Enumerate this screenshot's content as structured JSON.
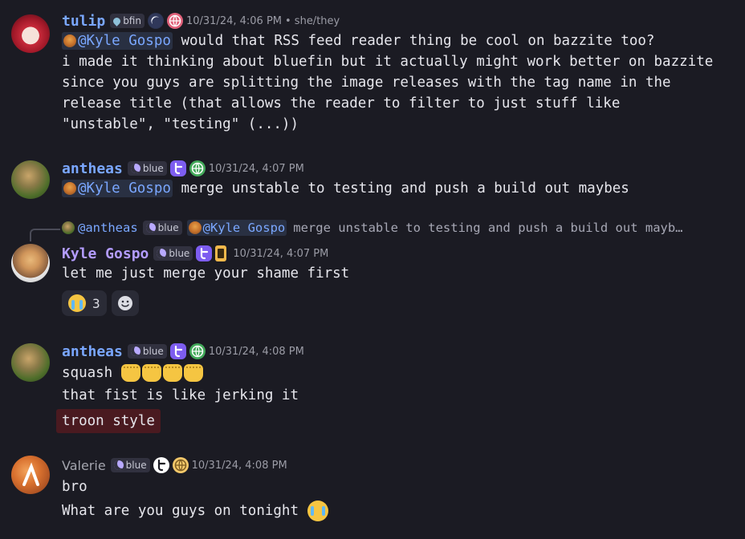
{
  "messages": [
    {
      "author": "tulip",
      "name_color": "#7aa7ff",
      "tag": "bfin",
      "timestamp": "10/31/24, 4:06 PM",
      "pronouns": "• she/they",
      "mention": "@Kyle Gospo",
      "first_line": " would that RSS feed reader thing be cool on bazzite too?",
      "rest": "i made it thinking about bluefin but it actually might work better on bazzite since you guys are splitting the image releases with the tag name in the release title (that allows the reader to filter to just stuff like \"unstable\", \"testing\" (...))"
    },
    {
      "author": "antheas",
      "name_color": "#7aa7ff",
      "tag": "blue",
      "timestamp": "10/31/24, 4:07 PM",
      "mention": "@Kyle Gospo",
      "text": " merge unstable to testing and push a build out maybes"
    },
    {
      "author": "Kyle Gospo",
      "name_color": "#b39cff",
      "tag": "blue",
      "timestamp": "10/31/24, 4:07 PM",
      "reply": {
        "author": "@antheas",
        "tag": "blue",
        "mention": "@Kyle Gospo",
        "text": "merge unstable to testing and push a build out mayb…"
      },
      "text": "let me just merge your shame first",
      "reactions": [
        {
          "emoji": "loudly-crying-face",
          "count": "3"
        },
        {
          "emoji": "add-reaction"
        }
      ]
    },
    {
      "author": "antheas",
      "name_color": "#7aa7ff",
      "tag": "blue",
      "timestamp": "10/31/24, 4:08 PM",
      "lines": [
        "squash",
        "that fist is like jerking it"
      ],
      "spoiler": "troon style"
    },
    {
      "author": "Valerie",
      "name_color": "#a3a4ad",
      "tag": "blue",
      "timestamp": "10/31/24, 4:08 PM",
      "lines": [
        "bro",
        "What are you guys on tonight"
      ]
    }
  ],
  "colors": {
    "background": "#1b1b23",
    "mention_bg": "#293042",
    "mention_text": "#7aa7ff",
    "spoiler_bg": "#4a1a20"
  }
}
